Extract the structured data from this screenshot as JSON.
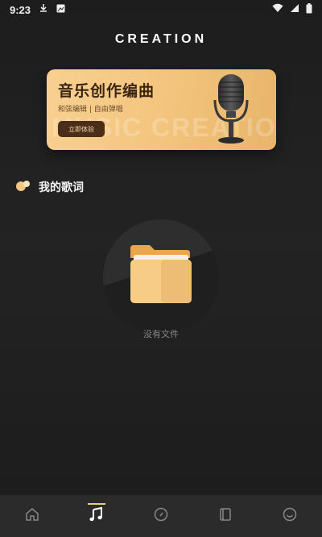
{
  "status_bar": {
    "time": "9:23"
  },
  "app": {
    "title": "CREATION"
  },
  "banner": {
    "title": "音乐创作编曲",
    "subtitle": "和弦编辑 | 自由弹唱",
    "button_label": "立即体验",
    "watermark": "MUSIC CREATION"
  },
  "section": {
    "title": "我的歌词"
  },
  "empty_state": {
    "message": "没有文件"
  },
  "tabs": [
    {
      "name": "home",
      "icon": "home-icon"
    },
    {
      "name": "music",
      "icon": "music-note-icon",
      "active": true
    },
    {
      "name": "discover",
      "icon": "compass-icon"
    },
    {
      "name": "library",
      "icon": "book-icon"
    },
    {
      "name": "profile",
      "icon": "smiley-icon"
    }
  ],
  "colors": {
    "accent": "#f2c782",
    "background": "#1f1f1f",
    "tab_bar": "#2b2b2b"
  }
}
